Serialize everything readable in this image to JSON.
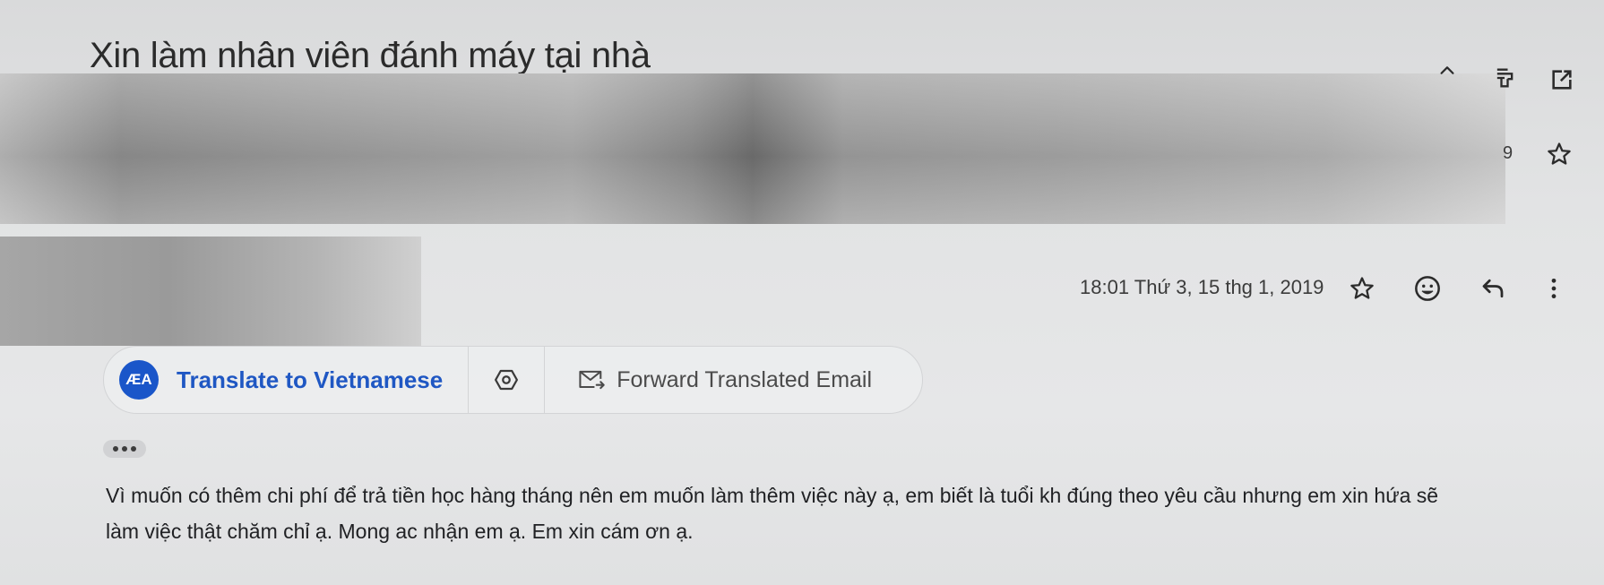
{
  "email": {
    "subject": "Xin làm nhân viên đánh máy tại nhà",
    "thread_count": "9",
    "timestamp": "18:01 Thứ 3, 15 thg 1, 2019",
    "body_lines": [
      "Vì muốn có thêm chi phí để trả tiền học hàng tháng nên em muốn làm thêm việc này ạ, em biết là tuổi kh đúng theo yêu cầu nhưng em xin hứa sẽ",
      "làm việc thật chăm chỉ ạ. Mong ac nhận em ạ. Em xin cám ơn ạ."
    ]
  },
  "translate_bar": {
    "translate_label": "Translate to Vietnamese",
    "forward_label": "Forward Translated Email",
    "badge_text": "ÆA"
  },
  "icons": {
    "collapse": "chevron-up-icon",
    "print": "print-icon",
    "open_new_window": "open-in-new-icon",
    "star": "star-outline-icon",
    "emoji": "emoji-smile-icon",
    "reply": "reply-icon",
    "more": "more-vert-icon",
    "translate": "translate-icon",
    "settings": "settings-hex-icon",
    "forward_email": "forward-email-icon"
  },
  "colors": {
    "accent": "#1f57c3",
    "badge": "#1a56c9"
  }
}
